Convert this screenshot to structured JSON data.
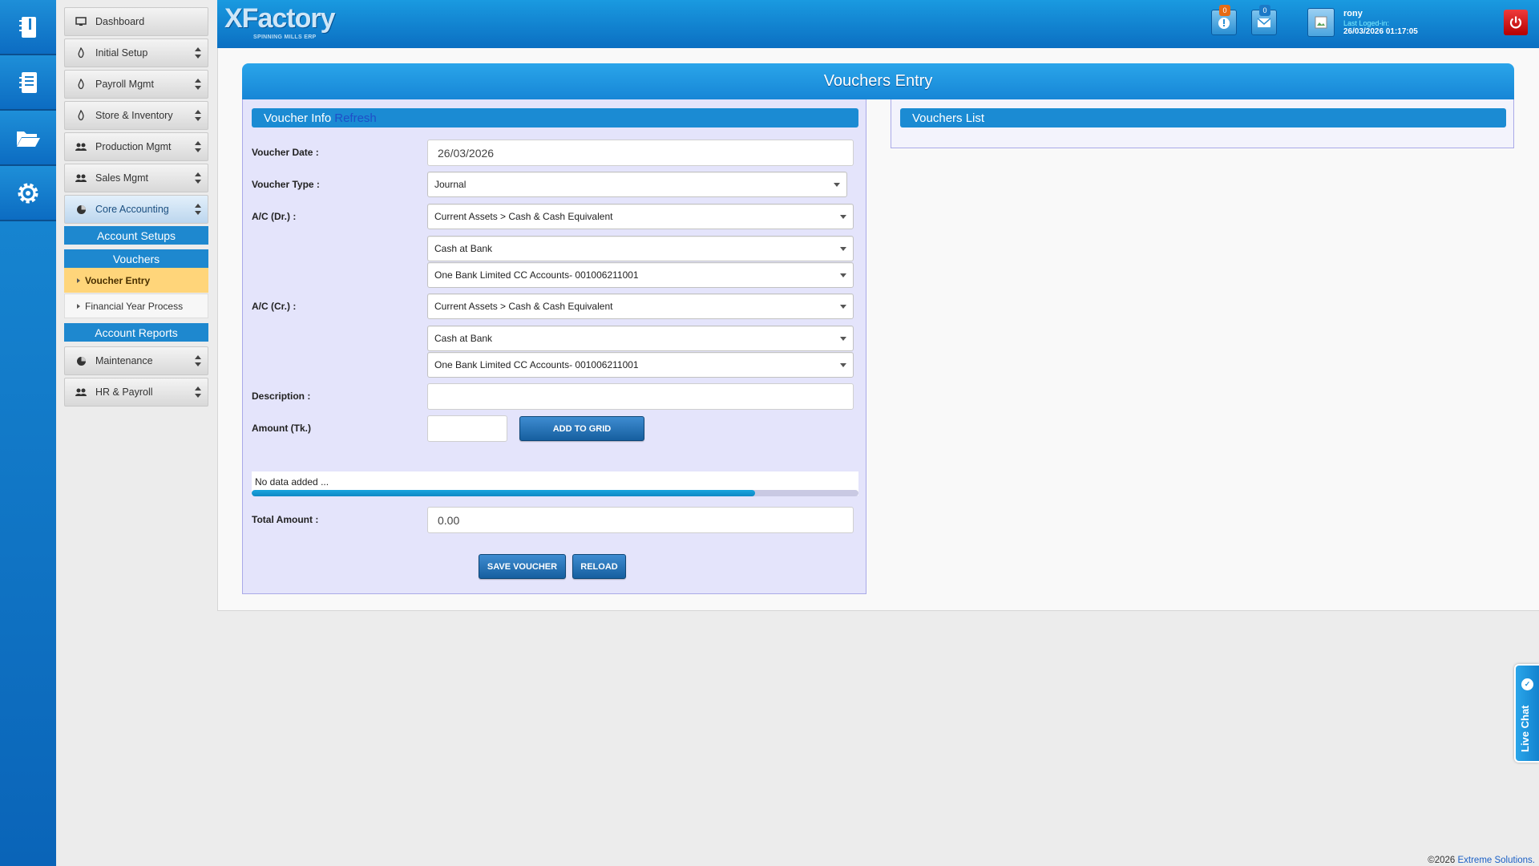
{
  "app": {
    "logo_main": "XFactory",
    "logo_sub": "SPINNING MILLS ERP",
    "colors": {
      "primary": "#1b8bd3",
      "active_menu": "#ffd57a",
      "danger": "#d10000"
    }
  },
  "rail": {
    "items": [
      {
        "icon": "notebook-icon"
      },
      {
        "icon": "document-list-icon"
      },
      {
        "icon": "folder-open-icon"
      },
      {
        "icon": "gear-icon"
      }
    ]
  },
  "sidebar": {
    "menus": [
      {
        "label": "Dashboard",
        "icon": "monitor-icon"
      },
      {
        "label": "Initial Setup",
        "icon": "flame-icon"
      },
      {
        "label": "Payroll Mgmt",
        "icon": "flame-icon"
      },
      {
        "label": "Store & Inventory",
        "icon": "flame-icon"
      },
      {
        "label": "Production Mgmt",
        "icon": "users-icon"
      },
      {
        "label": "Sales Mgmt",
        "icon": "users-icon"
      },
      {
        "label": "Core Accounting",
        "icon": "pie-icon"
      }
    ],
    "sections": {
      "account_setups": "Account Setups",
      "vouchers": "Vouchers",
      "voucher_entry": "Voucher Entry",
      "financial_year": "Financial Year Process",
      "account_reports": "Account Reports"
    },
    "bottom_menus": [
      {
        "label": "Maintenance",
        "icon": "pie-icon"
      },
      {
        "label": "HR & Payroll",
        "icon": "users-icon"
      }
    ]
  },
  "header": {
    "notifications_count": "0",
    "messages_count": "0",
    "user_name": "rony",
    "last_logged_label": "Last Loged-in:",
    "last_logged_time": "26/03/2026 01:17:05"
  },
  "page": {
    "title": "Vouchers Entry",
    "voucher_info": "Voucher Info",
    "refresh": "Refresh",
    "vouchers_list": "Vouchers List"
  },
  "form": {
    "voucher_date_label": "Voucher Date :",
    "voucher_date": "26/03/2026",
    "voucher_type_label": "Voucher Type :",
    "voucher_type": "Journal",
    "ac_dr_label": "A/C (Dr.) :",
    "dr_group": "Current Assets > Cash & Cash Equivalent",
    "dr_sub": "Cash at Bank",
    "dr_account": "One Bank Limited CC Accounts- 001006211001",
    "ac_cr_label": "A/C (Cr.) :",
    "cr_group": "Current Assets > Cash & Cash Equivalent",
    "cr_sub": "Cash at Bank",
    "cr_account": "One Bank Limited CC Accounts- 001006211001",
    "description_label": "Description :",
    "description": "",
    "amount_label": "Amount (Tk.)",
    "amount": "",
    "add_to_grid": "ADD TO GRID",
    "grid_empty": "No data added ...",
    "grid_progress_fraction": 0.83,
    "total_amount_label": "Total Amount :",
    "total_amount": "0.00",
    "save_voucher": "SAVE VOUCHER",
    "reload": "RELOAD"
  },
  "livechat": {
    "label": "Live Chat"
  },
  "footer": {
    "copyright": "©2026",
    "company": "Extreme Solutions."
  }
}
